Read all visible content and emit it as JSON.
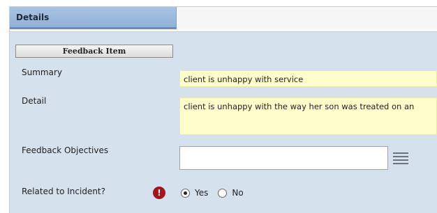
{
  "tabs": [
    {
      "label": "Details",
      "active": true
    }
  ],
  "section": {
    "button_label": "Feedback Item"
  },
  "form": {
    "summary": {
      "label": "Summary",
      "value": "client is unhappy with service"
    },
    "detail": {
      "label": "Detail",
      "value": "client is unhappy with the way her son was treated on an"
    },
    "objectives": {
      "label": "Feedback Objectives",
      "value": ""
    },
    "incident": {
      "label": "Related to Incident?",
      "alert_badge": "!",
      "options": [
        "Yes",
        "No"
      ],
      "selected": "Yes"
    }
  },
  "colors": {
    "tab_active": "#9ab8dc",
    "panel": "#d6e1ee",
    "readonly_field": "#fefecd",
    "alert": "#a4151d"
  },
  "icons": {
    "list": "list-menu-icon",
    "alert": "exclamation-badge-icon"
  }
}
